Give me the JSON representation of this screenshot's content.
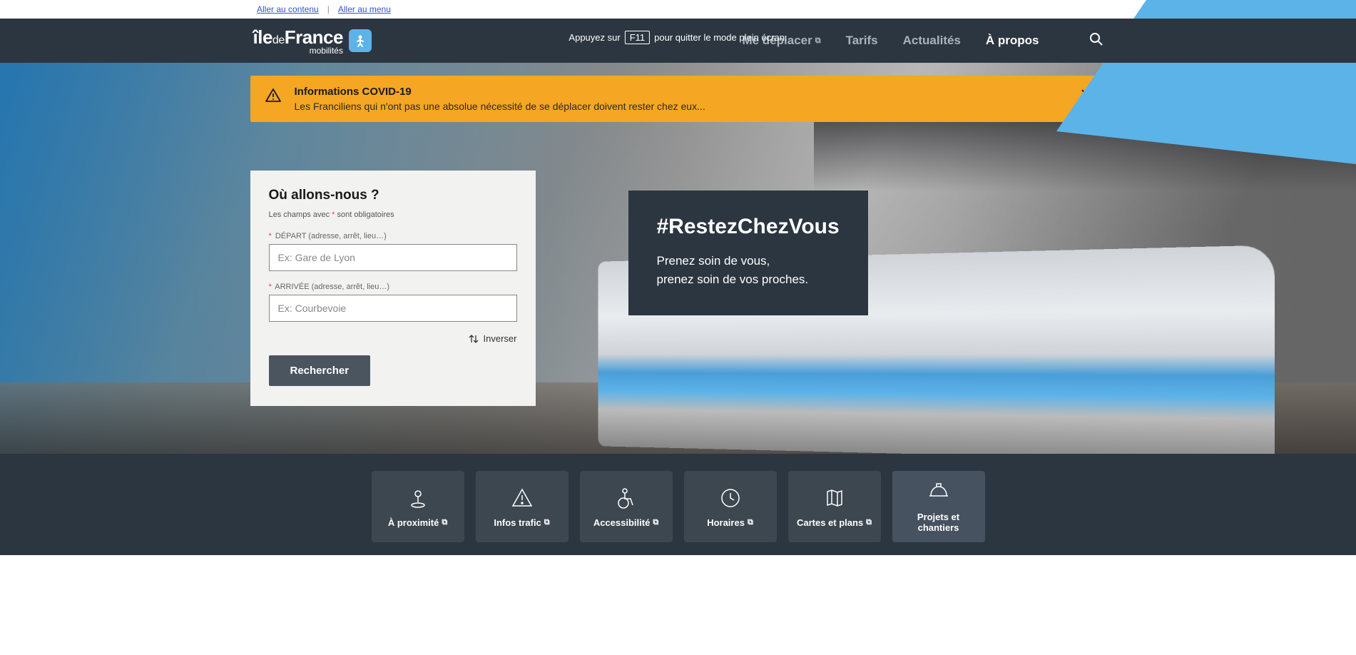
{
  "skip": {
    "content": "Aller au contenu",
    "menu": "Aller au menu"
  },
  "fullscreen": {
    "pre": "Appuyez sur",
    "key": "F11",
    "post": "pour quitter le mode plein écran."
  },
  "nav": {
    "items": [
      {
        "label": "Me déplacer"
      },
      {
        "label": "Tarifs"
      },
      {
        "label": "Actualités"
      },
      {
        "label": "À propos"
      }
    ]
  },
  "alert": {
    "title": "Informations COVID-19",
    "text": "Les Franciliens qui n'ont pas une absolue nécessité de se déplacer doivent rester chez eux..."
  },
  "search": {
    "title": "Où allons-nous ?",
    "required_note_pre": "Les champs avec ",
    "required_note_post": " sont obligatoires",
    "depart_label": "DÉPART (adresse, arrêt, lieu…)",
    "depart_placeholder": "Ex: Gare de Lyon",
    "arrivee_label": "ARRIVÉE (adresse, arrêt, lieu…)",
    "arrivee_placeholder": "Ex: Courbevoie",
    "inverse": "Inverser",
    "submit": "Rechercher"
  },
  "hero_msg": {
    "title": "#RestezChezVous",
    "line1": "Prenez soin de vous,",
    "line2": "prenez soin de vos proches."
  },
  "tiles": [
    {
      "label": "À proximité"
    },
    {
      "label": "Infos trafic"
    },
    {
      "label": "Accessibilité"
    },
    {
      "label": "Horaires"
    },
    {
      "label": "Cartes et plans"
    },
    {
      "label": "Projets et chantiers"
    }
  ]
}
